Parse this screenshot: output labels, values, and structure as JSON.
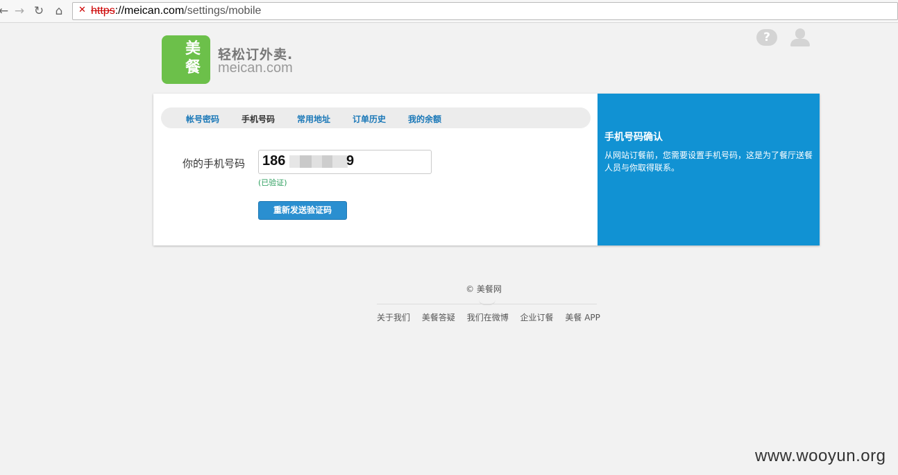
{
  "browser": {
    "url_scheme": "https",
    "url_host": "://meican.com",
    "url_path": "/settings/mobile"
  },
  "header": {
    "logo_char_1": "美",
    "logo_char_2": "餐",
    "slogan": "轻松订外卖.",
    "domain": "meican.com",
    "help_glyph": "?"
  },
  "tabs": [
    {
      "label": "帐号密码"
    },
    {
      "label": "手机号码"
    },
    {
      "label": "常用地址"
    },
    {
      "label": "订单历史"
    },
    {
      "label": "我的余额"
    }
  ],
  "form": {
    "label": "你的手机号码",
    "phone_prefix": "186",
    "phone_suffix": "9",
    "verified": "(已验证)",
    "resend_button": "重新发送验证码"
  },
  "side": {
    "title": "手机号码确认",
    "text": "从网站订餐前，您需要设置手机号码，这是为了餐厅送餐人员与你取得联系。"
  },
  "footer": {
    "copyright": "© 美餐网",
    "links": [
      "关于我们",
      "美餐答疑",
      "我们在微博",
      "企业订餐",
      "美餐 APP"
    ]
  },
  "watermark": "www.wooyun.org",
  "colors": {
    "brand_green": "#6cc04a",
    "panel_blue": "#1192d3",
    "button_blue": "#2a8fd0",
    "link_blue": "#1a78b8"
  },
  "icons": [
    "back-arrow-icon",
    "forward-arrow-icon",
    "reload-icon",
    "home-icon",
    "insecure-lock-icon",
    "help-icon",
    "user-icon"
  ]
}
